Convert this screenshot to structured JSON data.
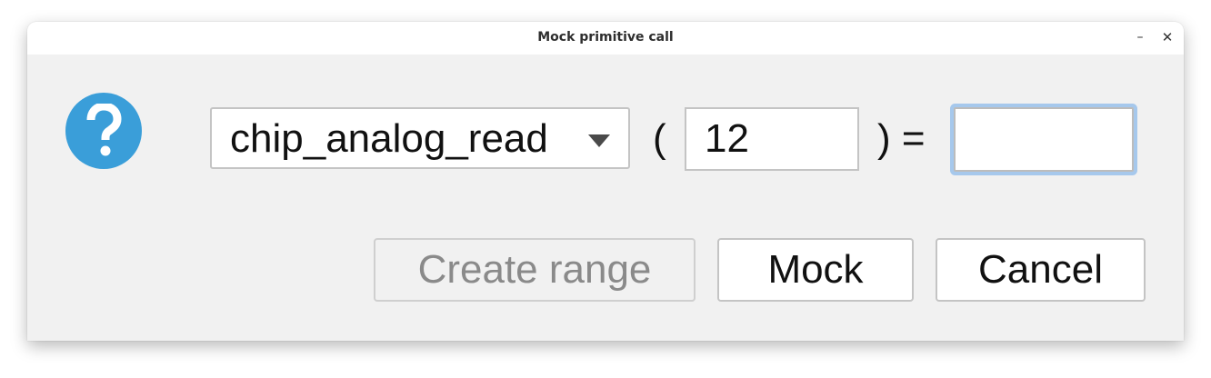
{
  "window": {
    "title": "Mock primitive call",
    "minimize_glyph": "–",
    "close_glyph": "✕"
  },
  "icon": {
    "name": "question-icon",
    "color": "#3a9ed9"
  },
  "form": {
    "primitive_selected": "chip_analog_read",
    "open_paren": "(",
    "argument_value": "12",
    "close_paren_equals": ") =",
    "result_value": ""
  },
  "buttons": {
    "create_range_label": "Create range",
    "create_range_enabled": false,
    "mock_label": "Mock",
    "cancel_label": "Cancel"
  },
  "colors": {
    "accent_focus": "#a6c8ec",
    "background": "#f1f1f1"
  }
}
